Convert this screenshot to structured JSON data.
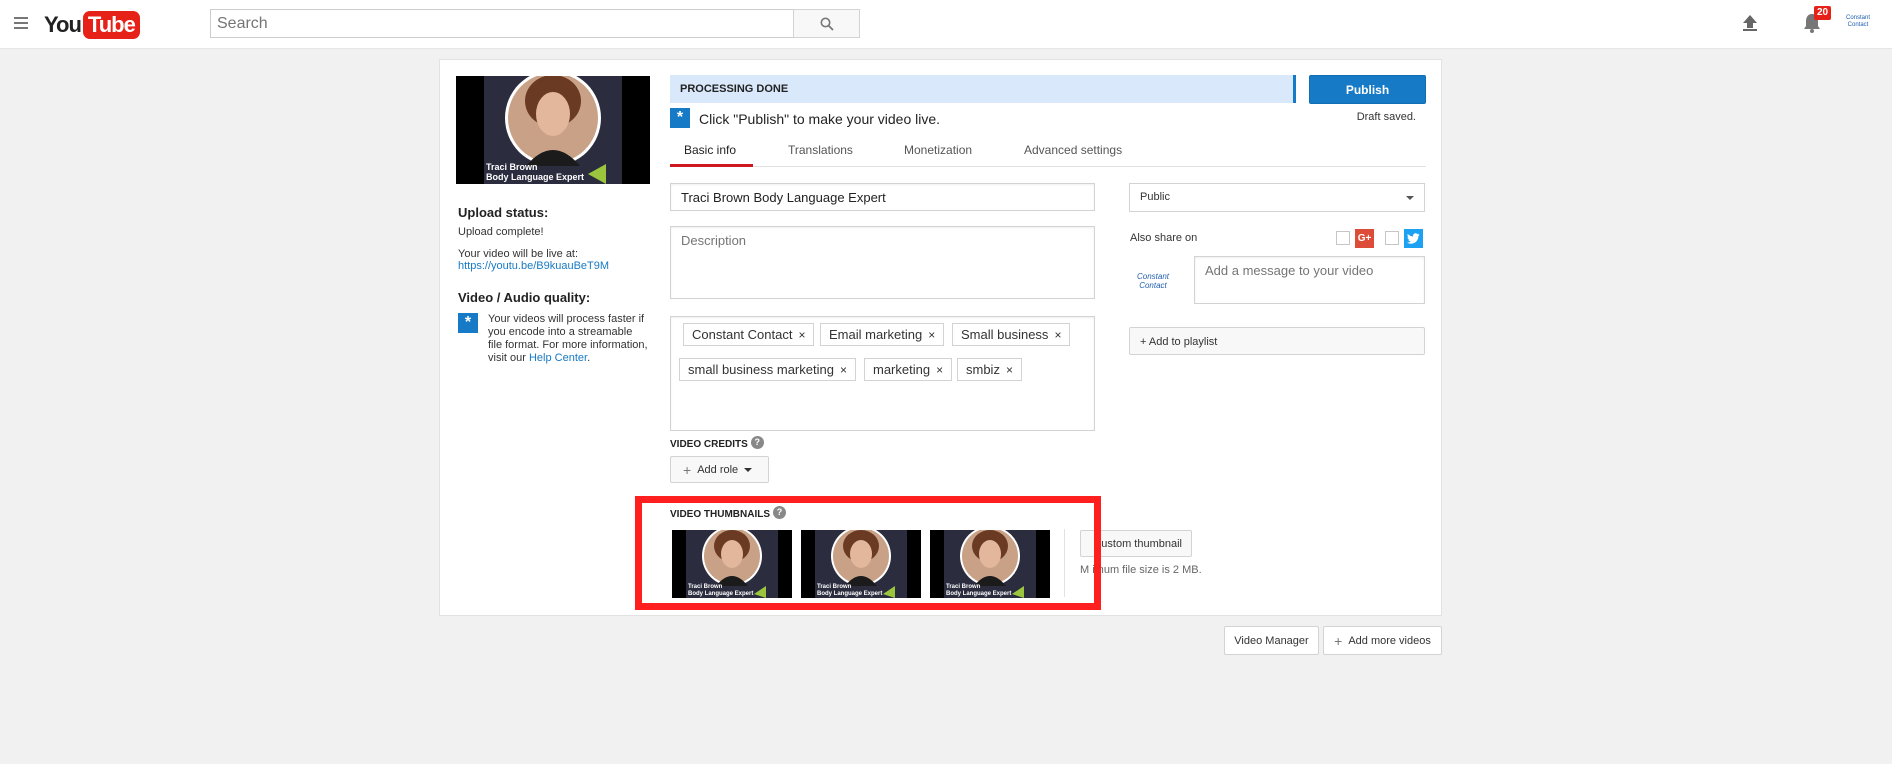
{
  "header": {
    "logo_you": "You",
    "logo_tube": "Tube",
    "search_placeholder": "Search",
    "notification_count": "20",
    "avatar_text": "Constant Contact"
  },
  "thumbnail": {
    "name_line1": "Traci Brown",
    "name_line2": "Body Language Expert"
  },
  "left": {
    "upload_status_heading": "Upload status:",
    "upload_complete": "Upload complete!",
    "live_at": "Your video will be live at:",
    "video_url": "https://youtu.be/B9kuauBeT9M",
    "quality_heading": "Video / Audio quality:",
    "quality_text": "Your videos will process faster if you encode into a streamable file format. For more information, visit our",
    "help_center": "Help Center",
    "period": "."
  },
  "status": {
    "processing": "PROCESSING DONE",
    "publish": "Publish",
    "draft_saved": "Draft saved.",
    "click_publish": "Click \"Publish\" to make your video live."
  },
  "tabs": [
    {
      "label": "Basic info",
      "active": true
    },
    {
      "label": "Translations",
      "active": false
    },
    {
      "label": "Monetization",
      "active": false
    },
    {
      "label": "Advanced settings",
      "active": false
    }
  ],
  "form": {
    "title_value": "Traci Brown Body Language Expert",
    "description_placeholder": "Description",
    "tags": [
      "Constant Contact",
      "Email marketing",
      "Small business",
      "small business marketing",
      "marketing",
      "smbiz"
    ],
    "tag_remove": "×",
    "credits_label": "VIDEO CREDITS",
    "add_role": "Add role",
    "help": "?",
    "thumbnails_label": "VIDEO THUMBNAILS",
    "custom_thumbnail": "ustom thumbnail",
    "max_size": "M   imum file size is 2 MB."
  },
  "right": {
    "privacy": "Public",
    "also_share": "Also share on",
    "gplus": "G+",
    "message_placeholder": "Add a message to your video",
    "cc_avatar": "Constant Contact",
    "add_playlist": "+ Add to playlist"
  },
  "footer": {
    "video_manager": "Video Manager",
    "add_more": "Add more videos"
  },
  "colors": {
    "accent_blue": "#167ac6",
    "youtube_red": "#e62117",
    "highlight_red": "#ff1f1f"
  }
}
